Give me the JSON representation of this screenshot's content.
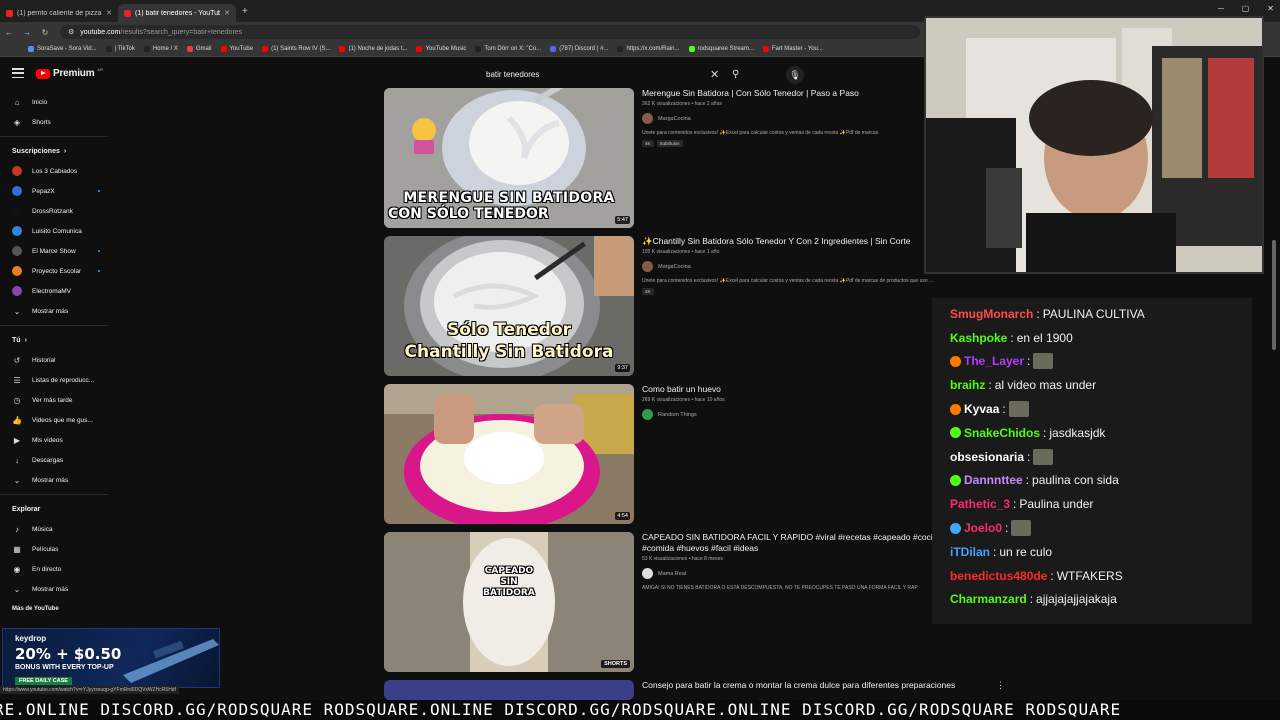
{
  "browser": {
    "tabs": [
      {
        "title": "(1) perrito caliente de pizza a l"
      },
      {
        "title": "(1) batir tenedores - YouTube"
      }
    ],
    "url_host": "youtube.com",
    "url_path": "/results?search_query=batir+tenedores",
    "bookmarks": [
      {
        "label": "SoraSave - Sora Vid...",
        "color": "#5a8dee"
      },
      {
        "label": "| TikTok",
        "color": "#222222"
      },
      {
        "label": "Home / X",
        "color": "#222222"
      },
      {
        "label": "Gmail",
        "color": "#ea4335"
      },
      {
        "label": "YouTube",
        "color": "#ff0000"
      },
      {
        "label": "(1) Saints Row IV (S...",
        "color": "#ff0000"
      },
      {
        "label": "(1) Noche de jodas t...",
        "color": "#ff0000"
      },
      {
        "label": "YouTube Music",
        "color": "#ff0000"
      },
      {
        "label": "Tom Dörr on X: \"Co...",
        "color": "#222222"
      },
      {
        "label": "(787) Discord | #...",
        "color": "#5865f2"
      },
      {
        "label": "https://x.com/Rain...",
        "color": "#222222"
      },
      {
        "label": "rodsquaree Stream...",
        "color": "#53fc18"
      },
      {
        "label": "Fart Master - You...",
        "color": "#ff0000"
      }
    ]
  },
  "youtube": {
    "logo_text": "Premium",
    "logo_region": "AR",
    "search_value": "batir tenedores"
  },
  "sidebar": {
    "top": [
      {
        "label": "Inicio",
        "icon": "home-icon",
        "glyph": "⌂"
      },
      {
        "label": "Shorts",
        "icon": "shorts-icon",
        "glyph": "◈"
      }
    ],
    "subs_title": "Suscripciones",
    "subs": [
      {
        "label": "Los 3 Cabiados",
        "color": "#c0392b",
        "dot": false
      },
      {
        "label": "PepazX",
        "color": "#3a6ad8",
        "dot": true
      },
      {
        "label": "DrossRotzank",
        "color": "#111111",
        "dot": false
      },
      {
        "label": "Luisito Comunica",
        "color": "#2e86de",
        "dot": false
      },
      {
        "label": "El Marce Show",
        "color": "#555555",
        "dot": true
      },
      {
        "label": "Proyecto Escolar",
        "color": "#e67e22",
        "dot": true
      },
      {
        "label": "ElectromaMV",
        "color": "#8e44ad",
        "dot": false
      }
    ],
    "more_label": "Mostrar más",
    "you_title": "Tú",
    "you": [
      {
        "label": "Historial",
        "glyph": "↺",
        "icon": "history-icon"
      },
      {
        "label": "Listas de reproducc...",
        "glyph": "☰",
        "icon": "playlists-icon"
      },
      {
        "label": "Ver más tarde",
        "glyph": "◷",
        "icon": "watch-later-icon"
      },
      {
        "label": "Videos que me gus...",
        "glyph": "👍",
        "icon": "liked-icon"
      },
      {
        "label": "Mis videos",
        "glyph": "▶",
        "icon": "my-videos-icon"
      },
      {
        "label": "Descargas",
        "glyph": "↓",
        "icon": "downloads-icon"
      }
    ],
    "explore_title": "Explorar",
    "explore": [
      {
        "label": "Música",
        "glyph": "♪",
        "icon": "music-icon"
      },
      {
        "label": "Películas",
        "glyph": "▦",
        "icon": "movies-icon"
      },
      {
        "label": "En directo",
        "glyph": "◉",
        "icon": "live-icon"
      }
    ],
    "more_yt": "Más de YouTube"
  },
  "results": [
    {
      "title": "Merengue Sin Batidora | Con Sólo Tenedor | Paso a Paso",
      "meta": "362 K visualizaciones • hace 2 años",
      "channel": "MargaCocina",
      "channel_color": "#8a5a44",
      "desc": "Únete para contenidos exclusivos! ✨Excel para calcular costos y ventas de cada receta ✨Pdf de marcas",
      "tags": [
        "4K",
        "Subtítulos"
      ],
      "duration": "5:47",
      "thumb_text": [
        "MERENGUE SIN BATIDORA",
        "CON SÓLO TENEDOR"
      ]
    },
    {
      "title": "✨Chantilly Sin Batidora Sólo Tenedor Y Con 2 Ingredientes | Sin Corte",
      "meta": "105 K visualizaciones • hace 1 año",
      "channel": "MargaCocina",
      "channel_color": "#8a5a44",
      "desc": "Únete para contenidos exclusivos! ✨Excel para calcular costos y ventas de cada receta ✨Pdf de marcas de productos que uso ...",
      "tags": [
        "4K"
      ],
      "duration": "9:37",
      "thumb_text": [
        "Sólo Tenedor",
        "Chantilly Sin Batidora"
      ]
    },
    {
      "title": "Como batir un huevo",
      "meta": "269 K visualizaciones • hace 10 años",
      "channel": "Random Things",
      "channel_color": "#2e9e4e",
      "duration": "4:54"
    },
    {
      "title": "CAPEADO SIN BATIDORA FACIL Y RAPIDO #viral #recetas #capeado #cocina #comida #huevos #facil #ideas",
      "meta": "53 K visualizaciones • hace 8 meses",
      "channel": "Mama Real",
      "channel_color": "#dddddd",
      "desc": "AMIGA! SI NO TIENES BATIDORA O ESTA DESCOMPUESTA, NO TE PREOCUPES TE PASO UNA FORMA FACIL Y RAP",
      "badge": "SHORTS",
      "thumb_text": [
        "CAPEADO",
        "SIN",
        "BATIDORA"
      ]
    },
    {
      "title": "Consejo para batir la crema o montar la crema dulce para diferentes preparaciones"
    }
  ],
  "chat": [
    {
      "user": "SmugMonarch",
      "text": "PAULINA CULTIVA",
      "color": "#ff4d4d",
      "emote": false,
      "badge": ""
    },
    {
      "user": "Kashpoke",
      "text": "en el 1900",
      "color": "#53fc18",
      "emote": false,
      "badge": ""
    },
    {
      "user": "The_Layer",
      "text": "",
      "color": "#b23cff",
      "emote": true,
      "badge": "#ff7b00"
    },
    {
      "user": "braihz",
      "text": "al video mas under",
      "color": "#53fc18",
      "emote": false,
      "badge": ""
    },
    {
      "user": "Kyvaa",
      "text": "",
      "color": "#ffffff",
      "emote": true,
      "badge": "#ff7b00"
    },
    {
      "user": "SnakeChidos",
      "text": "jasdkasjdk",
      "color": "#53fc18",
      "emote": false,
      "badge": "#53fc18"
    },
    {
      "user": "obsesionaria",
      "text": "",
      "color": "#ffffff",
      "emote": true,
      "badge": ""
    },
    {
      "user": "Dannnttee",
      "text": "paulina con sida",
      "color": "#c58aff",
      "emote": false,
      "badge": "#53fc18"
    },
    {
      "user": "Pathetic_3",
      "text": "Paulina under",
      "color": "#ff2a6d",
      "emote": false,
      "badge": ""
    },
    {
      "user": "Joelo0",
      "text": "",
      "color": "#ff2a6d",
      "emote": true,
      "badge": "#3ea6ff"
    },
    {
      "user": "iTDilan",
      "text": "un re culo",
      "color": "#3ea6ff",
      "emote": false,
      "badge": ""
    },
    {
      "user": "benedictus480de",
      "text": "WTFAKERS",
      "color": "#ff2a2a",
      "emote": false,
      "badge": ""
    },
    {
      "user": "Charmanzard",
      "text": "ajjajajajjajakaja",
      "color": "#53fc18",
      "emote": false,
      "badge": ""
    }
  ],
  "keydrop": {
    "logo": "keydrop",
    "main": "20% + $0.50",
    "sub": "BONUS WITH EVERY TOP-UP",
    "button": "FREE DAILY CASE"
  },
  "status_url": "https://www.youtube.com/watch?v=rYJyyrsxuqp-gYFmRrd0DQVxWZHcR5Hdf",
  "ticker": "RE.ONLINE DISCORD.GG/RODSQUARE RODSQUARE.ONLINE DISCORD.GG/RODSQUARE.ONLINE DISCORD.GG/RODSQUARE RODSQUARE"
}
